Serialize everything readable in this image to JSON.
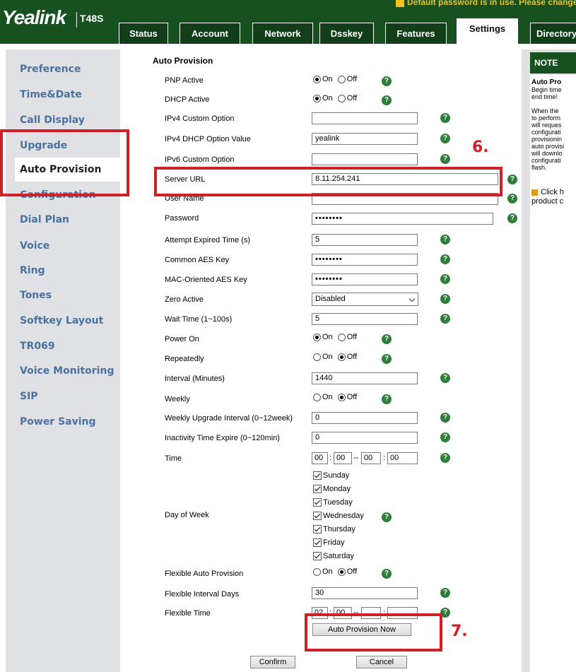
{
  "header": {
    "brand": "Yealink",
    "model": "T48S",
    "warning": "Default password is in use. Please change."
  },
  "tabs": [
    {
      "label": "Status",
      "active": false
    },
    {
      "label": "Account",
      "active": false
    },
    {
      "label": "Network",
      "active": false
    },
    {
      "label": "Dsskey",
      "active": false
    },
    {
      "label": "Features",
      "active": false
    },
    {
      "label": "Settings",
      "active": true
    },
    {
      "label": "Directory",
      "active": false
    }
  ],
  "sidebar": {
    "items": [
      {
        "label": "Preference"
      },
      {
        "label": "Time&Date"
      },
      {
        "label": "Call Display"
      },
      {
        "label": "Upgrade"
      },
      {
        "label": "Auto Provision",
        "active": true
      },
      {
        "label": "Configuration"
      },
      {
        "label": "Dial Plan"
      },
      {
        "label": "Voice"
      },
      {
        "label": "Ring"
      },
      {
        "label": "Tones"
      },
      {
        "label": "Softkey Layout"
      },
      {
        "label": "TR069"
      },
      {
        "label": "Voice Monitoring"
      },
      {
        "label": "SIP"
      },
      {
        "label": "Power Saving"
      }
    ]
  },
  "form": {
    "section_title": "Auto Provision",
    "radio_on": "On",
    "radio_off": "Off",
    "pnp_active": {
      "label": "PNP Active",
      "value": "On"
    },
    "dhcp_active": {
      "label": "DHCP Active",
      "value": "On"
    },
    "ipv4_custom_option": {
      "label": "IPv4 Custom Option",
      "value": ""
    },
    "ipv4_dhcp_option_value": {
      "label": "IPv4 DHCP Option Value",
      "value": "yealink"
    },
    "ipv6_custom_option": {
      "label": "IPv6 Custom Option",
      "value": ""
    },
    "server_url": {
      "label": "Server URL",
      "value": "8.11.254.241"
    },
    "user_name": {
      "label": "User Name",
      "value": ""
    },
    "password": {
      "label": "Password",
      "value": "••••••••"
    },
    "attempt_expired_time": {
      "label": "Attempt Expired Time (s)",
      "value": "5"
    },
    "common_aes_key": {
      "label": "Common AES Key",
      "value": "••••••••"
    },
    "mac_oriented_aes_key": {
      "label": "MAC-Oriented AES Key",
      "value": "••••••••"
    },
    "zero_active": {
      "label": "Zero Active",
      "value": "Disabled"
    },
    "wait_time": {
      "label": "Wait Time (1~100s)",
      "value": "5"
    },
    "power_on": {
      "label": "Power On",
      "value": "On"
    },
    "repeatedly": {
      "label": "Repeatedly",
      "value": "Off"
    },
    "interval": {
      "label": "Interval (Minutes)",
      "value": "1440"
    },
    "weekly": {
      "label": "Weekly",
      "value": "Off"
    },
    "weekly_upgrade_interval": {
      "label": "Weekly Upgrade Interval (0~12week)",
      "value": "0"
    },
    "inactivity_time_expire": {
      "label": "Inactivity Time Expire (0~120min)",
      "value": "0"
    },
    "time": {
      "label": "Time",
      "start_hour": "00",
      "start_min": "00",
      "end_hour": "00",
      "end_min": "00"
    },
    "day_of_week": {
      "label": "Day of Week",
      "days": [
        {
          "label": "Sunday",
          "checked": true
        },
        {
          "label": "Monday",
          "checked": true
        },
        {
          "label": "Tuesday",
          "checked": true
        },
        {
          "label": "Wednesday",
          "checked": true
        },
        {
          "label": "Thursday",
          "checked": true
        },
        {
          "label": "Friday",
          "checked": true
        },
        {
          "label": "Saturday",
          "checked": true
        }
      ]
    },
    "flexible_auto_provision": {
      "label": "Flexible Auto Provision",
      "value": "Off"
    },
    "flexible_interval_days": {
      "label": "Flexible Interval Days",
      "value": "30"
    },
    "flexible_time": {
      "label": "Flexible Time",
      "start_hour": "02",
      "start_min": "00",
      "end_hour": "",
      "end_min": ""
    },
    "auto_provision_now_label": "Auto Provision Now",
    "confirm_label": "Confirm",
    "cancel_label": "Cancel"
  },
  "annotations": {
    "step6": "6.",
    "step7": "7."
  },
  "note": {
    "title": "NOTE",
    "heading": "Auto Pro",
    "lines": [
      "Begin time",
      "end time!",
      "",
      "When the",
      "to perform",
      "will reques",
      "configurati",
      "provisionin",
      "auto provisi",
      "will downlo",
      "configurati",
      "flash."
    ],
    "click_text_1": "Click h",
    "click_text_2": "product c"
  },
  "colors": {
    "header_green": "#16511f",
    "sidebar_link": "#4a72a0",
    "annotation_red": "#cf2027",
    "help_green": "#2e7d3a"
  }
}
